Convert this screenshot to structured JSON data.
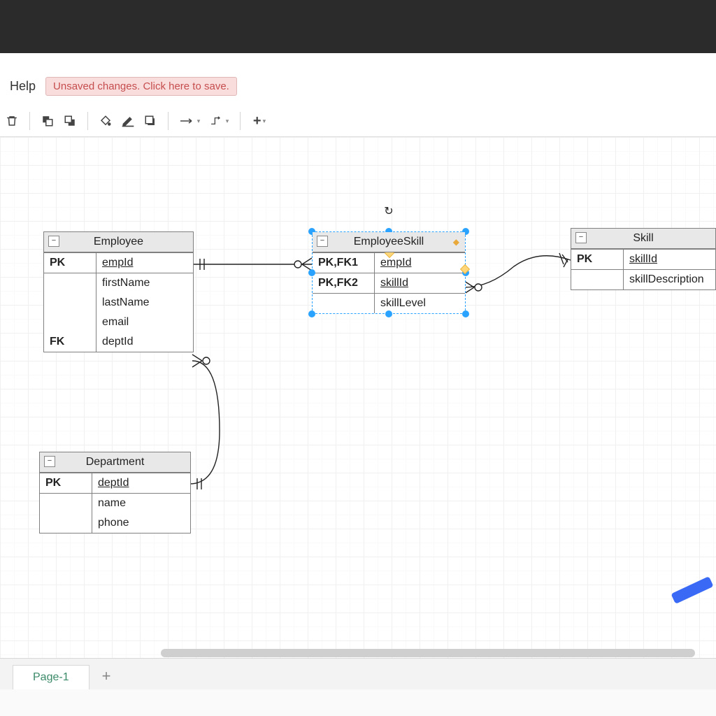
{
  "menu": {
    "help": "Help"
  },
  "save_notice": "Unsaved changes. Click here to save.",
  "toolbar_icons": {
    "delete": "delete-icon",
    "front": "bring-front-icon",
    "back": "send-back-icon",
    "fill": "fill-color-icon",
    "line": "line-color-icon",
    "shadow": "shadow-icon",
    "arrow": "connector-arrow-icon",
    "waypoint": "connector-waypoint-icon",
    "add": "add-icon"
  },
  "entities": {
    "employee": {
      "title": "Employee",
      "rows": [
        {
          "key": "PK",
          "name": "empId",
          "pk": true
        },
        {
          "key": "",
          "name": "firstName"
        },
        {
          "key": "",
          "name": "lastName"
        },
        {
          "key": "",
          "name": "email"
        },
        {
          "key": "FK",
          "name": "deptId"
        }
      ]
    },
    "employeeSkill": {
      "title": "EmployeeSkill",
      "rows": [
        {
          "key": "PK,FK1",
          "name": "empId",
          "pk": true
        },
        {
          "key": "PK,FK2",
          "name": "skillId",
          "pk": true
        },
        {
          "key": "",
          "name": "skillLevel"
        }
      ]
    },
    "skill": {
      "title": "Skill",
      "rows": [
        {
          "key": "PK",
          "name": "skillId",
          "pk": true
        },
        {
          "key": "",
          "name": "skillDescription"
        }
      ]
    },
    "department": {
      "title": "Department",
      "rows": [
        {
          "key": "PK",
          "name": "deptId",
          "pk": true
        },
        {
          "key": "",
          "name": "name"
        },
        {
          "key": "",
          "name": "phone"
        }
      ]
    }
  },
  "tabs": {
    "page1": "Page-1"
  },
  "colors": {
    "selection": "#29a3ff"
  }
}
